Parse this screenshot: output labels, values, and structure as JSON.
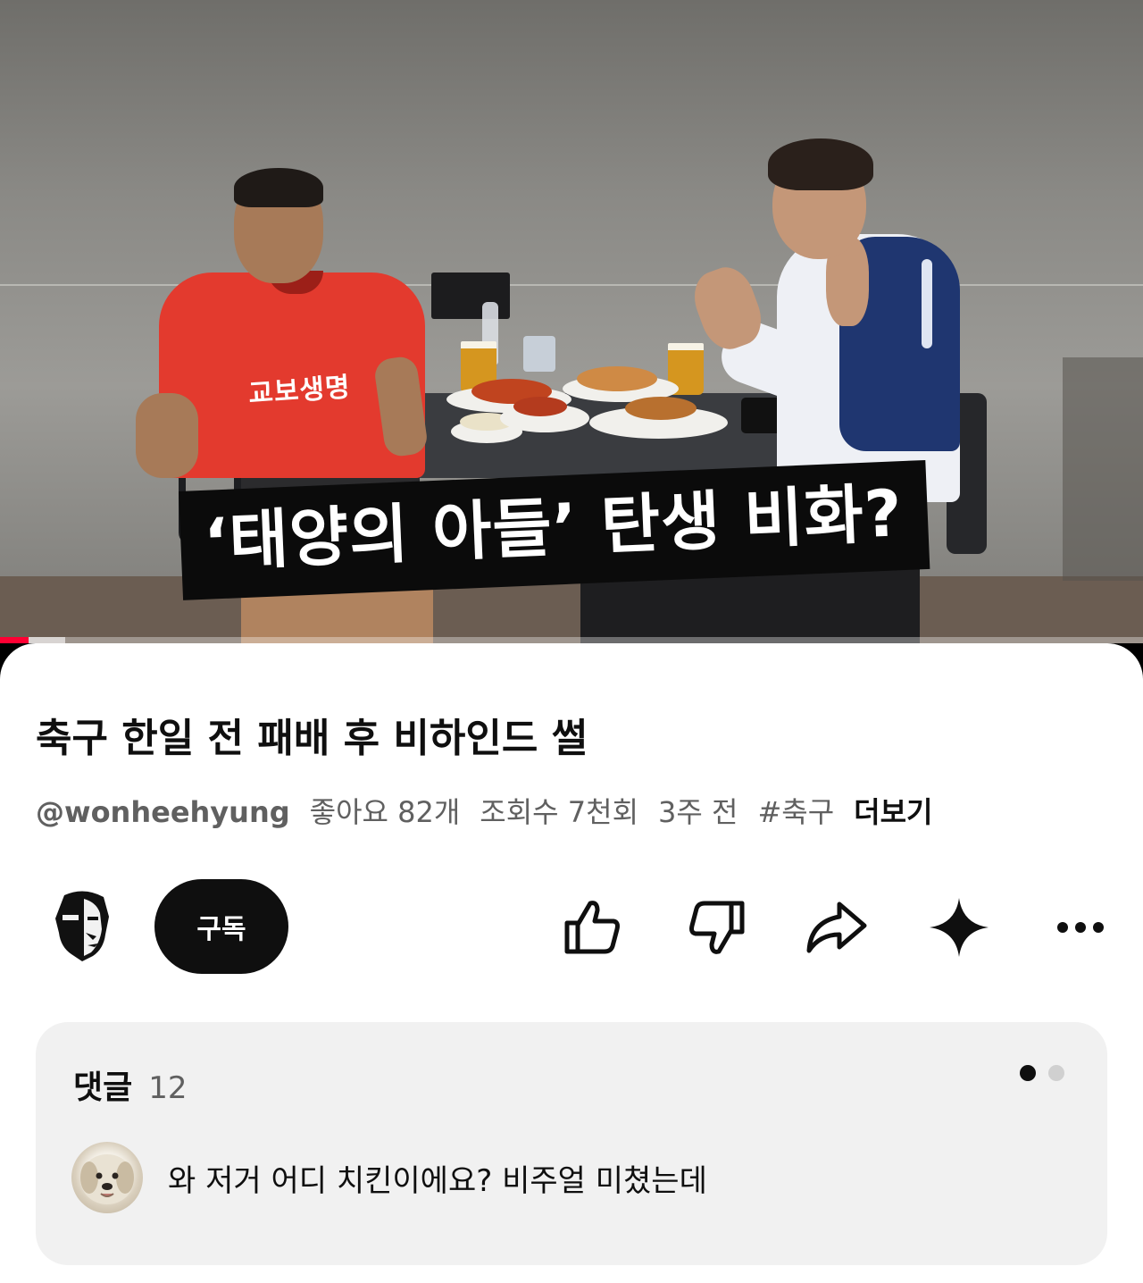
{
  "video": {
    "caption": "‘태양의 아들’ 탄생 비화?",
    "jersey_text": "교보생명",
    "progress_fraction": 0.025,
    "buffer_fraction": 0.057,
    "colors": {
      "progress": "#ff0033",
      "jersey": "#e33a2e",
      "jacket_navy": "#1f3670"
    }
  },
  "sheet": {
    "title": "축구 한일 전 패배 후 비하인드 썰",
    "meta": {
      "handle": "@wonheehyung",
      "likes": "좋아요 82개",
      "views": "조회수 7천회",
      "age": "3주 전",
      "hashtag": "#축구",
      "more": "더보기"
    },
    "actions": {
      "subscribe": "구독",
      "icons": [
        "thumbs-up-icon",
        "thumbs-down-icon",
        "share-icon",
        "sparkle-icon",
        "more-icon"
      ]
    },
    "comments": {
      "label": "댓글",
      "count": "12",
      "page_dots": [
        "active",
        "inactive"
      ],
      "first": {
        "text": "와 저거 어디 치킨이에요? 비주얼 미쳤는데"
      }
    }
  }
}
